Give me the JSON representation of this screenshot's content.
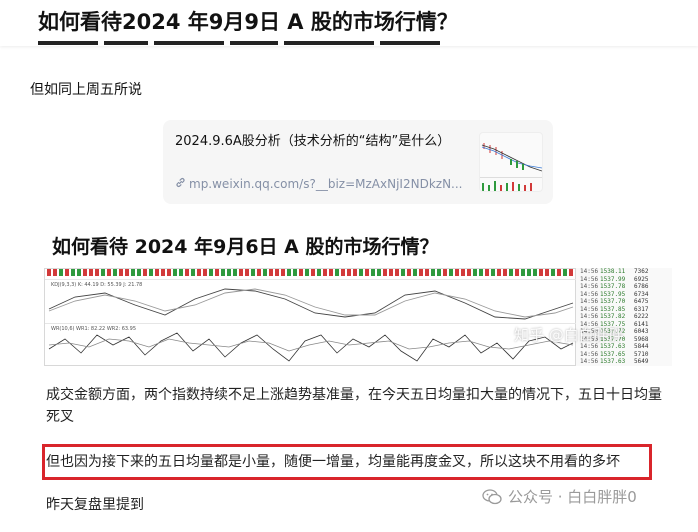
{
  "header": {
    "title": "如何看待2024 年9月9日 A 股的市场行情？"
  },
  "answer": {
    "lead_text": "但如同上周五所说",
    "link_card": {
      "title": "2024.9.6A股分析（技术分析的“结构”是什么）",
      "url": "mp.weixin.qq.com/s?__biz=MzAxNjI2NDkzN...",
      "thumbnail": "chart-thumbnail"
    },
    "image": {
      "title": "如何看待 2024 年9月6日 A 股的市场行情？",
      "indicator_labels": [
        "KDJ(9,3,3) K: 44.19 D: 55.39 J: 21.78",
        "WR(10,6) WR1: 82.22 WR2: 63.95"
      ],
      "ticker_rows": [
        {
          "time": "14:56",
          "price": "1538.11",
          "vol": "7362"
        },
        {
          "time": "14:56",
          "price": "1537.99",
          "vol": "6925"
        },
        {
          "time": "14:56",
          "price": "1537.78",
          "vol": "6786"
        },
        {
          "time": "14:56",
          "price": "1537.95",
          "vol": "6734"
        },
        {
          "time": "14:56",
          "price": "1537.70",
          "vol": "6475"
        },
        {
          "time": "14:56",
          "price": "1537.85",
          "vol": "6317"
        },
        {
          "time": "14:56",
          "price": "1537.82",
          "vol": "6222"
        },
        {
          "time": "14:56",
          "price": "1537.75",
          "vol": "6141"
        },
        {
          "time": "14:56",
          "price": "1537.72",
          "vol": "6043"
        },
        {
          "time": "14:56",
          "price": "1537.70",
          "vol": "5968"
        },
        {
          "time": "14:56",
          "price": "1537.63",
          "vol": "5844"
        },
        {
          "time": "14:56",
          "price": "1537.65",
          "vol": "5710"
        },
        {
          "time": "14:56",
          "price": "1537.63",
          "vol": "5649"
        }
      ],
      "paragraph1": "成交金额方面，两个指数持续不足上涨趋势基准量，在今天五日均量扣大量的情况下，五日十日均量死叉",
      "paragraph2": "但也因为接下来的五日均量都是小量，随便一增量，均量能再度金叉，所以这块不用看的多坏",
      "paragraph3": "昨天复盘里提到",
      "watermark_zhihu": "知乎 @白白胖胖",
      "watermark_wechat": "公众号 · 白白胖胖0"
    }
  },
  "colors": {
    "highlight_border": "#d9252b",
    "link_muted": "#8590a6",
    "card_bg": "#f6f6f6",
    "bar_up": "#d23a3a",
    "bar_down": "#2f9a3e"
  }
}
